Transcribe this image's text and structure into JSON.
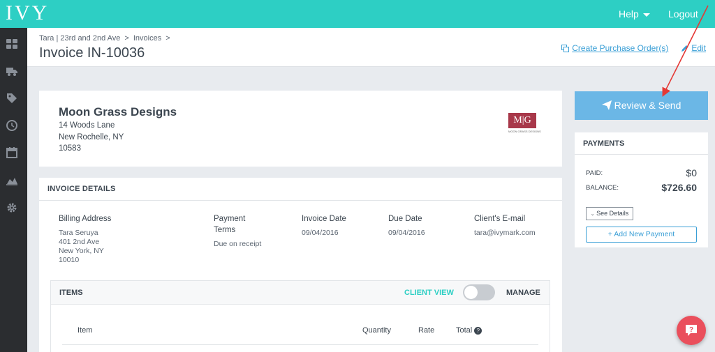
{
  "app": {
    "logo": "IVY"
  },
  "topnav": {
    "help": "Help",
    "logout": "Logout"
  },
  "sidebar": {
    "items": [
      {
        "icon": "dashboard-icon"
      },
      {
        "icon": "truck-icon"
      },
      {
        "icon": "tag-icon"
      },
      {
        "icon": "clock-icon"
      },
      {
        "icon": "calendar-icon"
      },
      {
        "icon": "chart-icon"
      },
      {
        "icon": "gear-icon"
      }
    ]
  },
  "header": {
    "breadcrumb": [
      "Tara | 23rd and 2nd Ave",
      "Invoices"
    ],
    "separator": ">",
    "title": "Invoice IN-10036",
    "create_po": "Create Purchase Order(s)",
    "edit": "Edit"
  },
  "company": {
    "name": "Moon Grass Designs",
    "address": [
      "14 Woods Lane",
      "New Rochelle, NY",
      "10583"
    ],
    "logo_text": "M|G",
    "logo_sub": "MOON GRASS DESIGNS"
  },
  "invoice_details": {
    "heading": "INVOICE DETAILS",
    "billing_label": "Billing Address",
    "billing": [
      "Tara Seruya",
      "401 2nd Ave",
      "New York, NY",
      "10010"
    ],
    "terms_label": [
      "Payment",
      "Terms"
    ],
    "terms": "Due on receipt",
    "invoice_date_label": "Invoice Date",
    "invoice_date": "09/04/2016",
    "due_date_label": "Due Date",
    "due_date": "09/04/2016",
    "email_label": "Client's E-mail",
    "email": "tara@ivymark.com"
  },
  "items": {
    "heading": "ITEMS",
    "client_view": "CLIENT VIEW",
    "manage": "MANAGE",
    "columns": [
      "Item",
      "Quantity",
      "Rate",
      "Total"
    ]
  },
  "actions": {
    "review_send": "Review & Send"
  },
  "payments": {
    "heading": "PAYMENTS",
    "paid_label": "PAID:",
    "paid": "$0",
    "balance_label": "BALANCE:",
    "balance": "$726.60",
    "see_details": "See Details",
    "add_payment": "+ Add New Payment"
  },
  "colors": {
    "topbar": "#2dcfc4",
    "accent": "#3a9fd6",
    "review_button": "#6bb7e6",
    "help_fab": "#ea4f5c",
    "annotation": "#e53935"
  }
}
